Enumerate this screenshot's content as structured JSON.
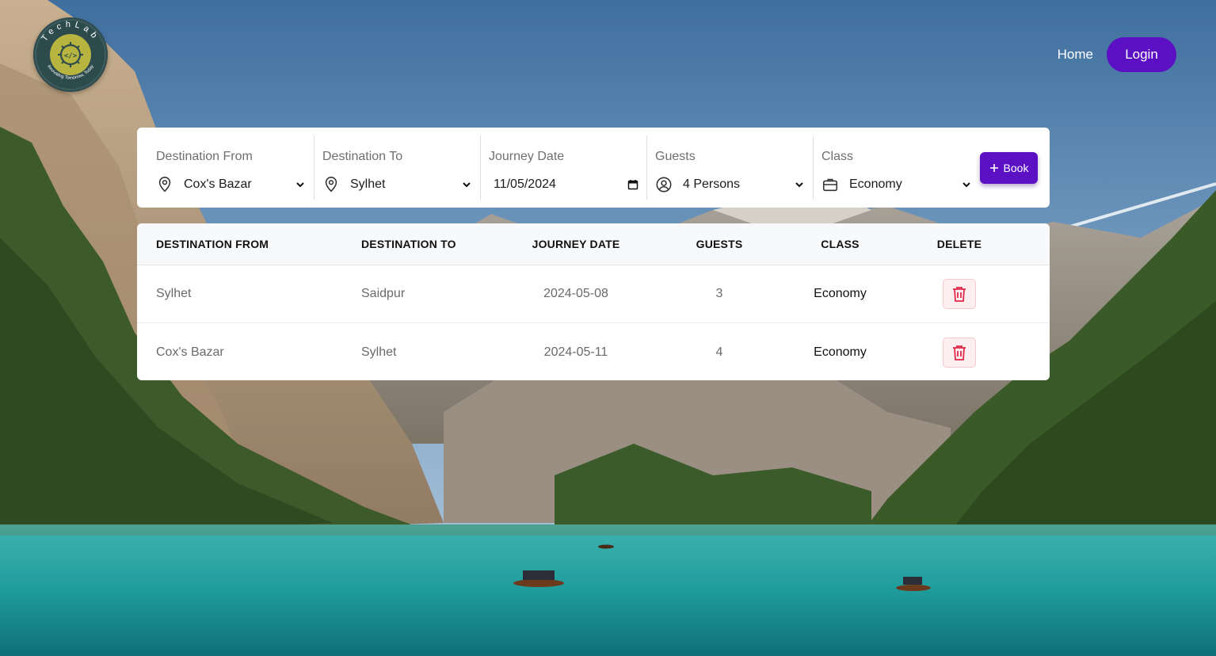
{
  "brand": {
    "logo_ring_text": "TechLab",
    "logo_tagline": "Innovating Tomorrow, Today"
  },
  "nav": {
    "home_label": "Home",
    "login_label": "Login"
  },
  "form": {
    "from": {
      "label": "Destination From",
      "value": "Cox's Bazar",
      "icon": "location-pin-icon"
    },
    "to": {
      "label": "Destination To",
      "value": "Sylhet",
      "icon": "location-pin-icon"
    },
    "date": {
      "label": "Journey Date",
      "value": "11/05/2024",
      "icon": "calendar-icon"
    },
    "guests": {
      "label": "Guests",
      "value": "4 Persons",
      "icon": "user-circle-icon"
    },
    "class": {
      "label": "Class",
      "value": "Economy",
      "icon": "briefcase-icon"
    },
    "book_label": "Book"
  },
  "table": {
    "headers": [
      "DESTINATION FROM",
      "DESTINATION TO",
      "JOURNEY DATE",
      "GUESTS",
      "CLASS",
      "DELETE"
    ],
    "rows": [
      {
        "from": "Sylhet",
        "to": "Saidpur",
        "date": "2024-05-08",
        "guests": "3",
        "class": "Economy"
      },
      {
        "from": "Cox's Bazar",
        "to": "Sylhet",
        "date": "2024-05-11",
        "guests": "4",
        "class": "Economy"
      }
    ]
  },
  "colors": {
    "accent": "#5b10c4",
    "delete_icon": "#e0284a",
    "delete_bg": "#fdeff0"
  }
}
